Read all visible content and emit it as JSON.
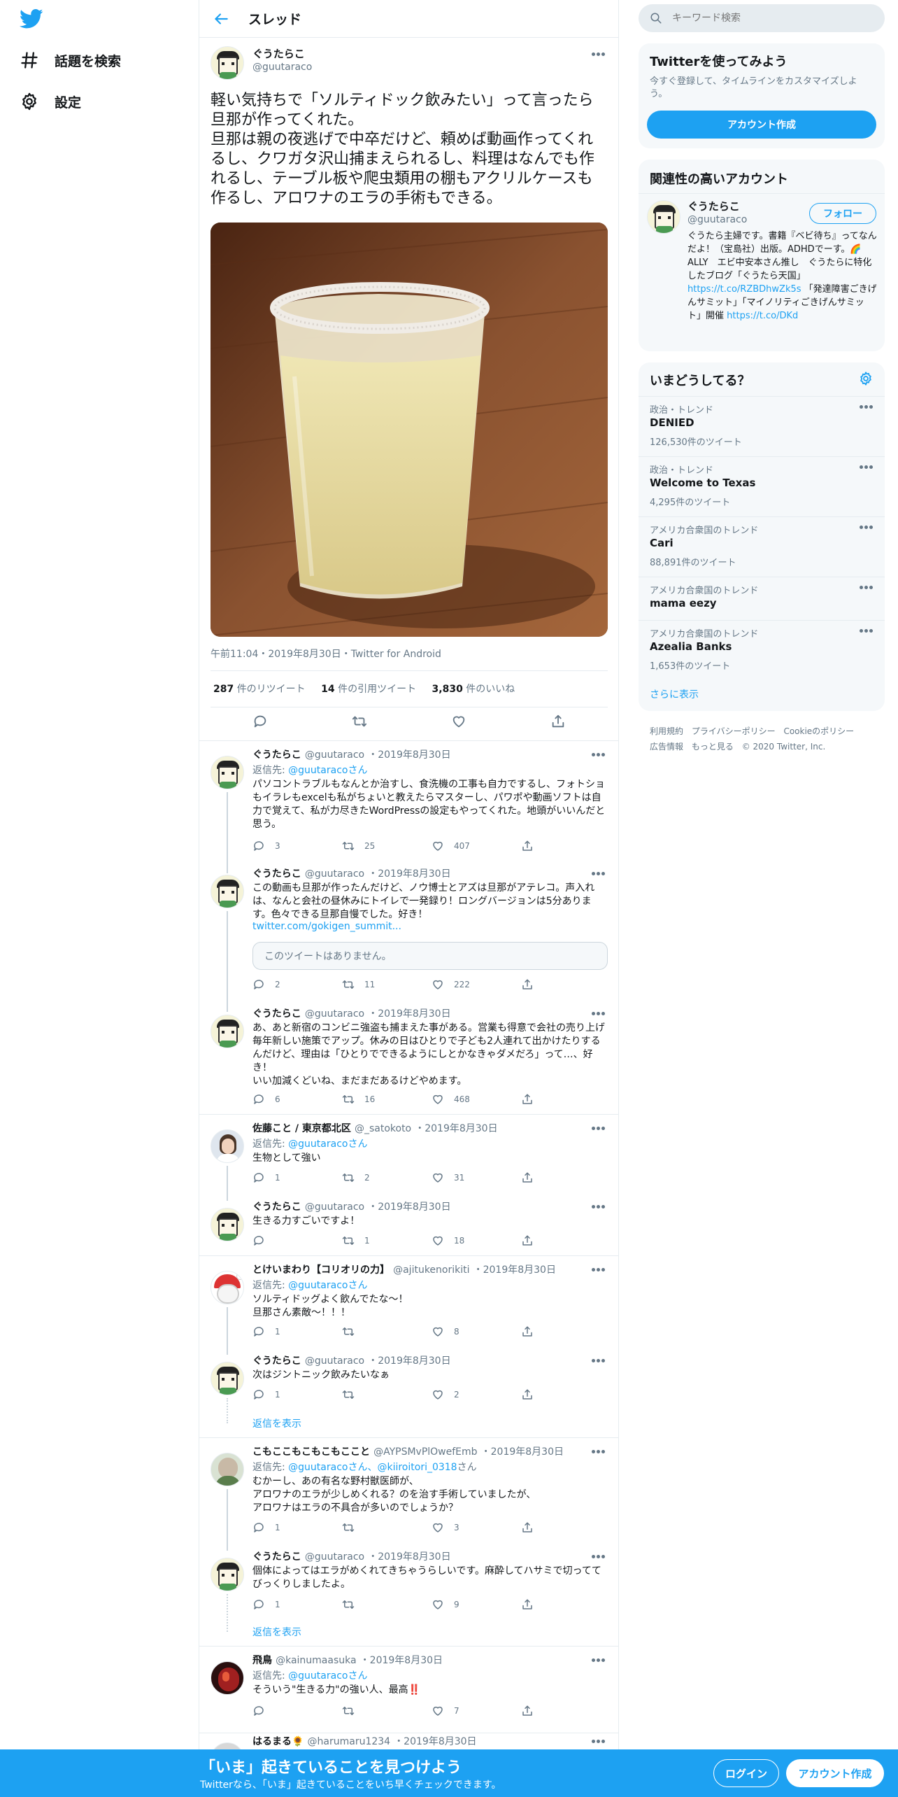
{
  "app": {
    "name": "Twitter",
    "accent": "#1da1f2"
  },
  "nav": {
    "explore": "話題を検索",
    "settings": "設定"
  },
  "header": {
    "title": "スレッド"
  },
  "main_tweet": {
    "name": "ぐうたらこ",
    "handle": "@guutaraco",
    "text": "軽い気持ちで「ソルティドック飲みたい」って言ったら旦那が作ってくれた。\n旦那は親の夜逃げで中卒だけど、頼めば動画作ってくれるし、クワガタ沢山捕まえられるし、料理はなんでも作れるし、テーブル板や爬虫類用の棚もアクリルケースも作るし、アロワナのエラの手術もできる。",
    "meta": "午前11:04・2019年8月30日・Twitter for Android",
    "retweets": "287",
    "retweets_label": "件のリツイート",
    "quotes": "14",
    "quotes_label": "件の引用ツイート",
    "likes": "3,830",
    "likes_label": "件のいいね"
  },
  "replies": [
    {
      "name": "ぐうたらこ",
      "handle": "@guutaraco",
      "date": "・2019年8月30日",
      "reply_to_prefix": "返信先: ",
      "reply_to": "@guutaracoさん",
      "reply_to_more": "",
      "text": "パソコントラブルもなんとか治すし、食洗機の工事も自力でするし、フォトショもイラレもexcelも私がちょいと教えたらマスターし、パワポや動画ソフトは自力で覚えて、私が力尽きたWordPressの設定もやってくれた。地頭がいいんだと思う。",
      "link": "",
      "unavailable": "",
      "reply_count": "3",
      "rt_count": "25",
      "like_count": "407"
    },
    {
      "name": "ぐうたらこ",
      "handle": "@guutaraco",
      "date": "・2019年8月30日",
      "reply_to_prefix": "",
      "reply_to": "",
      "reply_to_more": "",
      "text": "この動画も旦那が作ったんだけど、ノウ博士とアズは旦那がアテレコ。声入れは、なんと会社の昼休みにトイレで一発録り！ロングバージョンは5分あります。色々できる旦那自慢でした。好き！",
      "link": "twitter.com/gokigen_summit...",
      "unavailable": "このツイートはありません。",
      "reply_count": "2",
      "rt_count": "11",
      "like_count": "222"
    },
    {
      "name": "ぐうたらこ",
      "handle": "@guutaraco",
      "date": "・2019年8月30日",
      "reply_to_prefix": "",
      "reply_to": "",
      "reply_to_more": "",
      "text": "あ、あと新宿のコンビニ強盗も捕まえた事がある。営業も得意で会社の売り上げ毎年新しい施策でアップ。休みの日はひとりで子ども2人連れて出かけたりするんだけど、理由は「ひとりでできるようにしとかなきゃダメだろ」って…、好き！\nいい加減くどいね、まだまだあるけどやめます。",
      "link": "",
      "unavailable": "",
      "reply_count": "6",
      "rt_count": "16",
      "like_count": "468"
    },
    {
      "name": "佐藤こと / 東京都北区",
      "handle": "@_satokoto",
      "date": "・2019年8月30日",
      "reply_to_prefix": "返信先: ",
      "reply_to": "@guutaracoさん",
      "reply_to_more": "",
      "text": "生物として強い",
      "link": "",
      "unavailable": "",
      "reply_count": "1",
      "rt_count": "2",
      "like_count": "31"
    },
    {
      "name": "ぐうたらこ",
      "handle": "@guutaraco",
      "date": "・2019年8月30日",
      "reply_to_prefix": "",
      "reply_to": "",
      "reply_to_more": "",
      "text": "生きる力すごいですよ！",
      "link": "",
      "unavailable": "",
      "reply_count": "",
      "rt_count": "1",
      "like_count": "18"
    },
    {
      "name": "とけいまわり【コリオリの力】",
      "handle": "@ajitukenorikiti",
      "date": "・2019年8月30日",
      "reply_to_prefix": "返信先: ",
      "reply_to": "@guutaracoさん",
      "reply_to_more": "",
      "text": "ソルティドッグよく飲んでたな～！\n旦那さん素敵～！！！",
      "link": "",
      "unavailable": "",
      "reply_count": "1",
      "rt_count": "",
      "like_count": "8"
    },
    {
      "name": "ぐうたらこ",
      "handle": "@guutaraco",
      "date": "・2019年8月30日",
      "reply_to_prefix": "",
      "reply_to": "",
      "reply_to_more": "",
      "text": "次はジントニック飲みたいなぁ",
      "link": "",
      "unavailable": "",
      "reply_count": "1",
      "rt_count": "",
      "like_count": "2"
    },
    {
      "name": "こもここもこもこもここと",
      "handle": "@AYPSMvPlOwefEmb",
      "date": "・2019年8月30日",
      "reply_to_prefix": "返信先: ",
      "reply_to": "@guutaracoさん、@kiiroitori_0318",
      "reply_to_more": "さん",
      "text": "むかーし、あの有名な野村獣医師が、\nアロワナのエラが少しめくれる？のを治す手術していましたが、\nアロワナはエラの不具合が多いのでしょうか？",
      "link": "",
      "unavailable": "",
      "reply_count": "1",
      "rt_count": "",
      "like_count": "3"
    },
    {
      "name": "ぐうたらこ",
      "handle": "@guutaraco",
      "date": "・2019年8月30日",
      "reply_to_prefix": "",
      "reply_to": "",
      "reply_to_more": "",
      "text": "個体によってはエラがめくれてきちゃうらしいです。麻酔してハサミで切っててびっくりしましたよ。",
      "link": "",
      "unavailable": "",
      "reply_count": "1",
      "rt_count": "",
      "like_count": "9"
    },
    {
      "name": "飛鳥",
      "handle": "@kainumaasuka",
      "date": "・2019年8月30日",
      "reply_to_prefix": "返信先: ",
      "reply_to": "@guutaracoさん",
      "reply_to_more": "",
      "text": "そういう\"生きる力\"の強い人、最高‼️",
      "link": "",
      "unavailable": "",
      "reply_count": "",
      "rt_count": "",
      "like_count": "7"
    },
    {
      "name": "はるまる🌻",
      "handle": "@harumaru1234",
      "date": "・2019年8月30日",
      "reply_to_prefix": "",
      "reply_to": "",
      "reply_to_more": "",
      "text": "",
      "link": "",
      "unavailable": "",
      "reply_count": "",
      "rt_count": "",
      "like_count": ""
    }
  ],
  "show_replies": "返信を表示",
  "right": {
    "search_placeholder": "キーワード検索",
    "signup": {
      "title": "Twitterを使ってみよう",
      "desc": "今すぐ登録して、タイムラインをカスタマイズしよう。",
      "button": "アカウント作成"
    },
    "related": {
      "title": "関連性の高いアカウント",
      "name": "ぐうたらこ",
      "handle": "@guutaraco",
      "follow": "フォロー",
      "bio": "ぐうたら主婦です。書籍『ベビ待ち』ってなんだよ！（宝島社）出版。ADHDでーす。🌈ALLY　エビ中安本さん推し　ぐうたらに特化したブログ「ぐうたら天国」",
      "bio_link1": "https://t.co/RZBDhwZk5s",
      "bio_mid": "「発達障害ごきげんサミット」「マイノリティごきげんサミット」開催",
      "bio_link2": "https://t.co/DKd"
    },
    "trends_title": "いまどうしてる？",
    "trends": [
      {
        "meta": "政治・トレンド",
        "title": "DENIED",
        "count": "126,530件のツイート"
      },
      {
        "meta": "政治・トレンド",
        "title": "Welcome to Texas",
        "count": "4,295件のツイート"
      },
      {
        "meta": "アメリカ合衆国のトレンド",
        "title": "Cari",
        "count": "88,891件のツイート"
      },
      {
        "meta": "アメリカ合衆国のトレンド",
        "title": "mama eezy",
        "count": ""
      },
      {
        "meta": "アメリカ合衆国のトレンド",
        "title": "Azealia Banks",
        "count": "1,653件のツイート"
      }
    ],
    "show_more": "さらに表示",
    "footer": [
      "利用規約",
      "プライバシーポリシー",
      "Cookieのポリシー",
      "広告情報",
      "もっと見る",
      "© 2020 Twitter, Inc."
    ]
  },
  "bottom": {
    "title": "「いま」起きていることを見つけよう",
    "sub": "Twitterなら、「いま」起きていることをいち早くチェックできます。",
    "login": "ログイン",
    "signup": "アカウント作成"
  }
}
